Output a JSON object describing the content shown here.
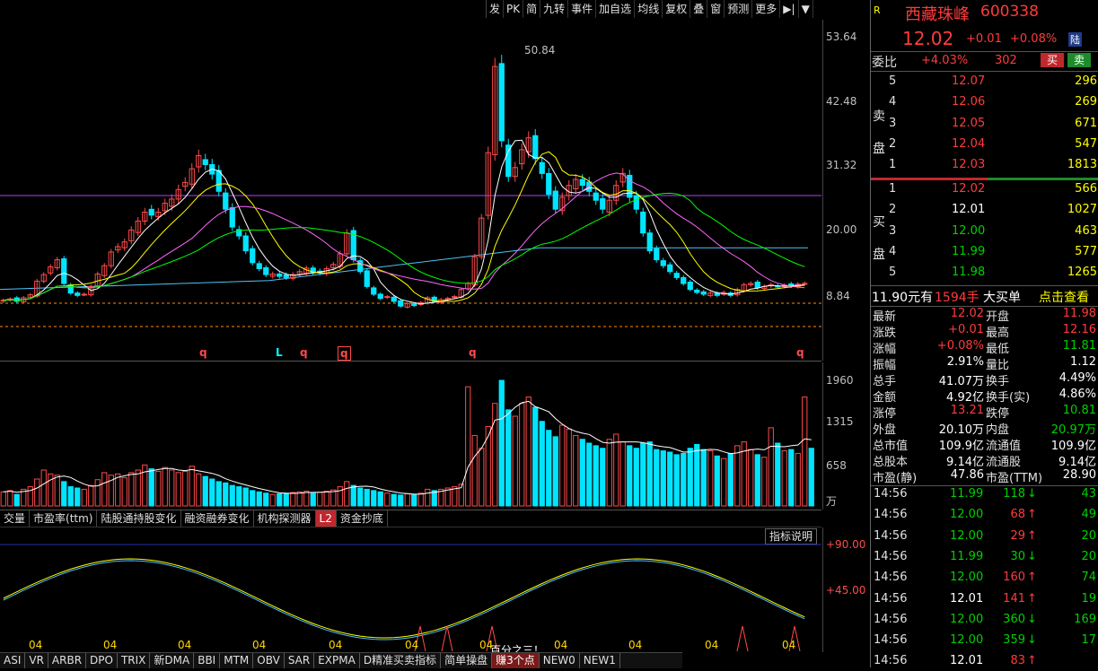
{
  "toolbar": [
    "发",
    "PK",
    "简",
    "九转",
    "事件",
    "加自选",
    "均线",
    "复权",
    "叠",
    "窗",
    "预测",
    "更多",
    "▶|",
    "▼"
  ],
  "main_axis": [
    "53.64",
    "42.48",
    "31.32",
    "20.00",
    "8.84"
  ],
  "peak_label": "50.84",
  "vol_axis": [
    "1960",
    "1315",
    "658",
    "万"
  ],
  "ind_axis": [
    "+90.00",
    "+45.00"
  ],
  "signal_labels": [
    "q",
    "L",
    "q",
    "q",
    "q",
    "q"
  ],
  "x_labels": [
    "04",
    "04",
    "04",
    "04",
    "04",
    "04",
    "04",
    "04",
    "04",
    "04",
    "04"
  ],
  "indicator_annotation": "百分之三！",
  "indicator_help": "指标说明",
  "indicator_tabs": [
    "交量",
    "市盈率(ttm)",
    "陆股通持股变化",
    "融资融券变化",
    "机构探测器",
    "L2",
    "资金抄底"
  ],
  "bottom_tabs": [
    "ASI",
    "VR",
    "ARBR",
    "DPO",
    "TRIX",
    "新DMA",
    "BBI",
    "MTM",
    "OBV",
    "SAR",
    "EXPMA",
    "D精准买卖指标",
    "简单操盘",
    "赚3个点",
    "NEW0",
    "NEW1"
  ],
  "quote": {
    "badge": "R",
    "name": "西藏珠峰",
    "code": "600338",
    "price": "12.02",
    "change": "+0.01",
    "change_pct": "+0.08%",
    "market_tag": "陆",
    "weibi_label": "委比",
    "weibi": "+4.03%",
    "weicha": "302",
    "buy_btn": "买",
    "sell_btn": "卖",
    "sell_side_label": [
      "卖",
      "盘"
    ],
    "buy_side_label": [
      "买",
      "盘"
    ],
    "asks": [
      {
        "level": "5",
        "price": "12.07",
        "vol": "296"
      },
      {
        "level": "4",
        "price": "12.06",
        "vol": "269"
      },
      {
        "level": "3",
        "price": "12.05",
        "vol": "671"
      },
      {
        "level": "2",
        "price": "12.04",
        "vol": "547"
      },
      {
        "level": "1",
        "price": "12.03",
        "vol": "1813"
      }
    ],
    "bids": [
      {
        "level": "1",
        "price": "12.02",
        "vol": "566"
      },
      {
        "level": "2",
        "price": "12.01",
        "vol": "1027"
      },
      {
        "level": "3",
        "price": "12.00",
        "vol": "463"
      },
      {
        "level": "4",
        "price": "11.99",
        "vol": "577"
      },
      {
        "level": "5",
        "price": "11.98",
        "vol": "1265"
      }
    ],
    "bigorder": {
      "price": "11.90元有",
      "qty": "1594手",
      "type": "大买单",
      "link": "点击查看"
    },
    "stats": [
      [
        "最新",
        "12.02",
        "开盘",
        "11.98"
      ],
      [
        "涨跌",
        "+0.01",
        "最高",
        "12.16"
      ],
      [
        "涨幅",
        "+0.08%",
        "最低",
        "11.81"
      ],
      [
        "振幅",
        "2.91%",
        "量比",
        "1.12"
      ],
      [
        "总手",
        "41.07万",
        "换手",
        "4.49%"
      ],
      [
        "金额",
        "4.92亿",
        "换手(实)",
        "4.86%"
      ],
      [
        "涨停",
        "13.21",
        "跌停",
        "10.81"
      ],
      [
        "外盘",
        "20.10万",
        "内盘",
        "20.97万"
      ],
      [
        "总市值",
        "109.9亿",
        "流通值",
        "109.9亿"
      ],
      [
        "总股本",
        "9.14亿",
        "流通股",
        "9.14亿"
      ],
      [
        "市盈(静)",
        "47.86",
        "市盈(TTM)",
        "28.90"
      ]
    ],
    "ticks": [
      {
        "time": "14:56",
        "price": "11.99",
        "vol": "118",
        "dir": "down",
        "n": "43"
      },
      {
        "time": "14:56",
        "price": "12.00",
        "vol": "68",
        "dir": "up",
        "n": "49"
      },
      {
        "time": "14:56",
        "price": "12.00",
        "vol": "29",
        "dir": "up",
        "n": "20"
      },
      {
        "time": "14:56",
        "price": "11.99",
        "vol": "30",
        "dir": "down",
        "n": "20"
      },
      {
        "time": "14:56",
        "price": "12.00",
        "vol": "160",
        "dir": "up",
        "n": "74"
      },
      {
        "time": "14:56",
        "price": "12.01",
        "vol": "141",
        "dir": "up",
        "n": "19"
      },
      {
        "time": "14:56",
        "price": "12.00",
        "vol": "360",
        "dir": "down",
        "n": "169"
      },
      {
        "time": "14:56",
        "price": "12.00",
        "vol": "359",
        "dir": "down",
        "n": "17"
      },
      {
        "time": "14:56",
        "price": "12.01",
        "vol": "83",
        "dir": "up",
        "n": ""
      }
    ]
  },
  "chart_data": {
    "type": "candlestick",
    "ylim": [
      0,
      60
    ],
    "closes": [
      9.2,
      9.4,
      9.0,
      9.6,
      10.1,
      12.4,
      13.5,
      14.8,
      16.0,
      12.0,
      10.4,
      10.0,
      10.2,
      11.5,
      13.6,
      15.0,
      17.3,
      18.2,
      19.0,
      21.0,
      22.5,
      24.0,
      23.5,
      24.0,
      25.5,
      26.2,
      27.8,
      29.0,
      31.3,
      33.5,
      32.0,
      30.4,
      27.5,
      24.5,
      21.5,
      20.0,
      17.5,
      15.5,
      14.5,
      13.5,
      13.6,
      13.2,
      13.0,
      13.5,
      14.0,
      14.6,
      13.8,
      13.8,
      14.5,
      15.2,
      17.0,
      20.5,
      16.0,
      14.0,
      11.5,
      10.2,
      9.5,
      9.8,
      9.0,
      8.2,
      8.6,
      8.3,
      8.8,
      9.6,
      9.0,
      9.3,
      9.5,
      9.8,
      11.0,
      12.0,
      16.5,
      23.0,
      34.0,
      48.5,
      36.0,
      30.0,
      31.5,
      34.5,
      36.5,
      33.0,
      30.5,
      27.0,
      24.5,
      26.5,
      28.5,
      29.5,
      28.5,
      27.5,
      26.0,
      24.5,
      26.0,
      28.5,
      30.5,
      26.5,
      24.5,
      20.5,
      17.5,
      16.0,
      15.0,
      14.0,
      13.0,
      12.0,
      11.0,
      10.5,
      10.2,
      10.4,
      10.0,
      10.5,
      10.0,
      11.0,
      11.8,
      12.0,
      11.3,
      11.5,
      11.8,
      11.5,
      11.7,
      11.6,
      11.9,
      12.02
    ],
    "ma_colors": [
      "#ffffff",
      "#ffff00",
      "#ff66ff",
      "#00ff00",
      "#4fc3f7"
    ],
    "volume": [
      220,
      240,
      180,
      260,
      300,
      420,
      560,
      500,
      480,
      380,
      300,
      280,
      260,
      320,
      410,
      520,
      480,
      500,
      440,
      520,
      560,
      640,
      580,
      540,
      600,
      560,
      520,
      540,
      620,
      500,
      460,
      420,
      380,
      360,
      320,
      300,
      280,
      240,
      220,
      200,
      180,
      190,
      200,
      210,
      220,
      230,
      200,
      210,
      230,
      250,
      300,
      380,
      320,
      280,
      260,
      240,
      220,
      200,
      180,
      170,
      190,
      180,
      200,
      260,
      240,
      260,
      280,
      300,
      340,
      1860,
      1100,
      900,
      1240,
      1600,
      1960,
      1500,
      1400,
      1600,
      1700,
      1540,
      1320,
      1180,
      1080,
      1260,
      1200,
      1100,
      1040,
      980,
      940,
      900,
      1040,
      1120,
      1000,
      940,
      900,
      980,
      1000,
      880,
      860,
      840,
      800,
      820,
      900,
      960,
      880,
      860,
      780,
      740,
      820,
      940,
      1000,
      880,
      800,
      760,
      1220,
      980,
      860,
      880,
      820,
      1700,
      900
    ]
  }
}
